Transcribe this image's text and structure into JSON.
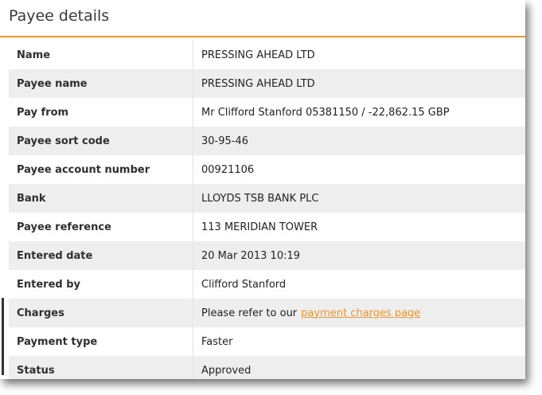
{
  "header": {
    "title": "Payee details"
  },
  "rows": [
    {
      "label": "Name",
      "value": "PRESSING AHEAD LTD"
    },
    {
      "label": "Payee name",
      "value": "PRESSING AHEAD LTD"
    },
    {
      "label": "Pay from",
      "value": "Mr Clifford Stanford 05381150 / -22,862.15 GBP"
    },
    {
      "label": "Payee sort code",
      "value": "30-95-46"
    },
    {
      "label": "Payee account number",
      "value": "00921106"
    },
    {
      "label": "Bank",
      "value": "LLOYDS TSB BANK PLC"
    },
    {
      "label": "Payee reference",
      "value": "113 MERIDIAN TOWER"
    },
    {
      "label": "Entered date",
      "value": "20 Mar 2013 10:19"
    },
    {
      "label": "Entered by",
      "value": "Clifford Stanford"
    },
    {
      "label": "Charges",
      "value": "Please refer to our",
      "link": "payment charges page"
    },
    {
      "label": "Payment type",
      "value": "Faster"
    },
    {
      "label": "Status",
      "value": "Approved"
    }
  ],
  "colors": {
    "accent": "#e8962c",
    "row_alt": "#eeeeee"
  }
}
